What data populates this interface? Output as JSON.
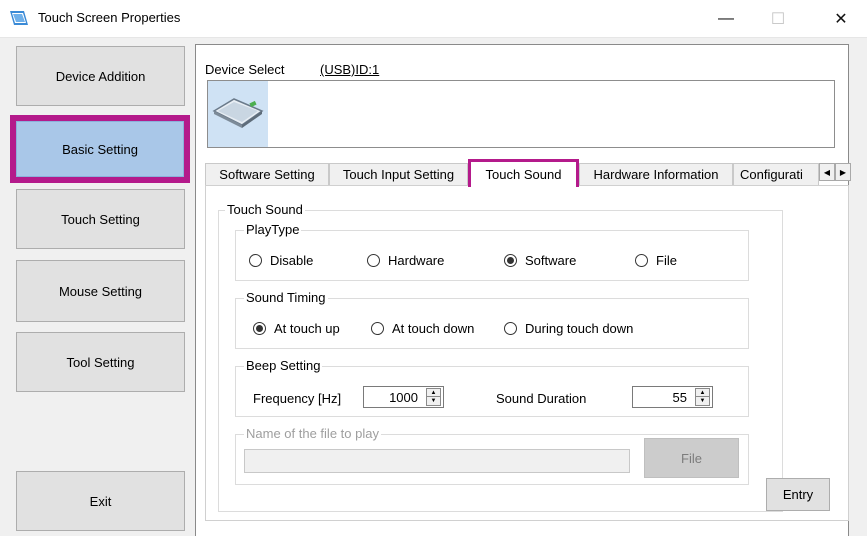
{
  "window": {
    "title": "Touch Screen Properties",
    "minimize_glyph": "—",
    "maximize_glyph": "☐",
    "close_glyph": "✕"
  },
  "sidebar": {
    "items": [
      {
        "label": "Device Addition"
      },
      {
        "label": "Basic Setting"
      },
      {
        "label": "Touch Setting"
      },
      {
        "label": "Mouse Setting"
      },
      {
        "label": "Tool Setting"
      }
    ],
    "exit_label": "Exit",
    "selected_item": "Basic Setting"
  },
  "device_select": {
    "label": "Device Select",
    "device_id": "(USB)ID:1",
    "device_icon": "touch-panel-icon"
  },
  "tabs": {
    "items": [
      {
        "label": "Software Setting"
      },
      {
        "label": "Touch Input Setting"
      },
      {
        "label": "Touch Sound"
      },
      {
        "label": "Hardware Information"
      },
      {
        "label": "Configurati"
      }
    ],
    "selected": "Touch Sound",
    "scroll_left_icon": "chevron-left-icon",
    "scroll_right_icon": "chevron-right-icon"
  },
  "touch_sound": {
    "group_label": "Touch Sound",
    "play_type": {
      "label": "PlayType",
      "options": [
        "Disable",
        "Hardware",
        "Software",
        "File"
      ],
      "selected": "Software"
    },
    "sound_timing": {
      "label": "Sound Timing",
      "options": [
        "At touch up",
        "At touch down",
        "During touch down"
      ],
      "selected": "At touch up"
    },
    "beep": {
      "label": "Beep Setting",
      "frequency_label": "Frequency [Hz]",
      "frequency_value": "1000",
      "duration_label": "Sound Duration",
      "duration_value": "55"
    },
    "file": {
      "label": "Name of the file to play",
      "value": "",
      "button_label": "File"
    },
    "entry_label": "Entry"
  },
  "colors": {
    "highlight_frame": "#b41a8b",
    "selected_sidebar_fill": "#a9c7e8",
    "window_bg": "#f0f0f0"
  }
}
